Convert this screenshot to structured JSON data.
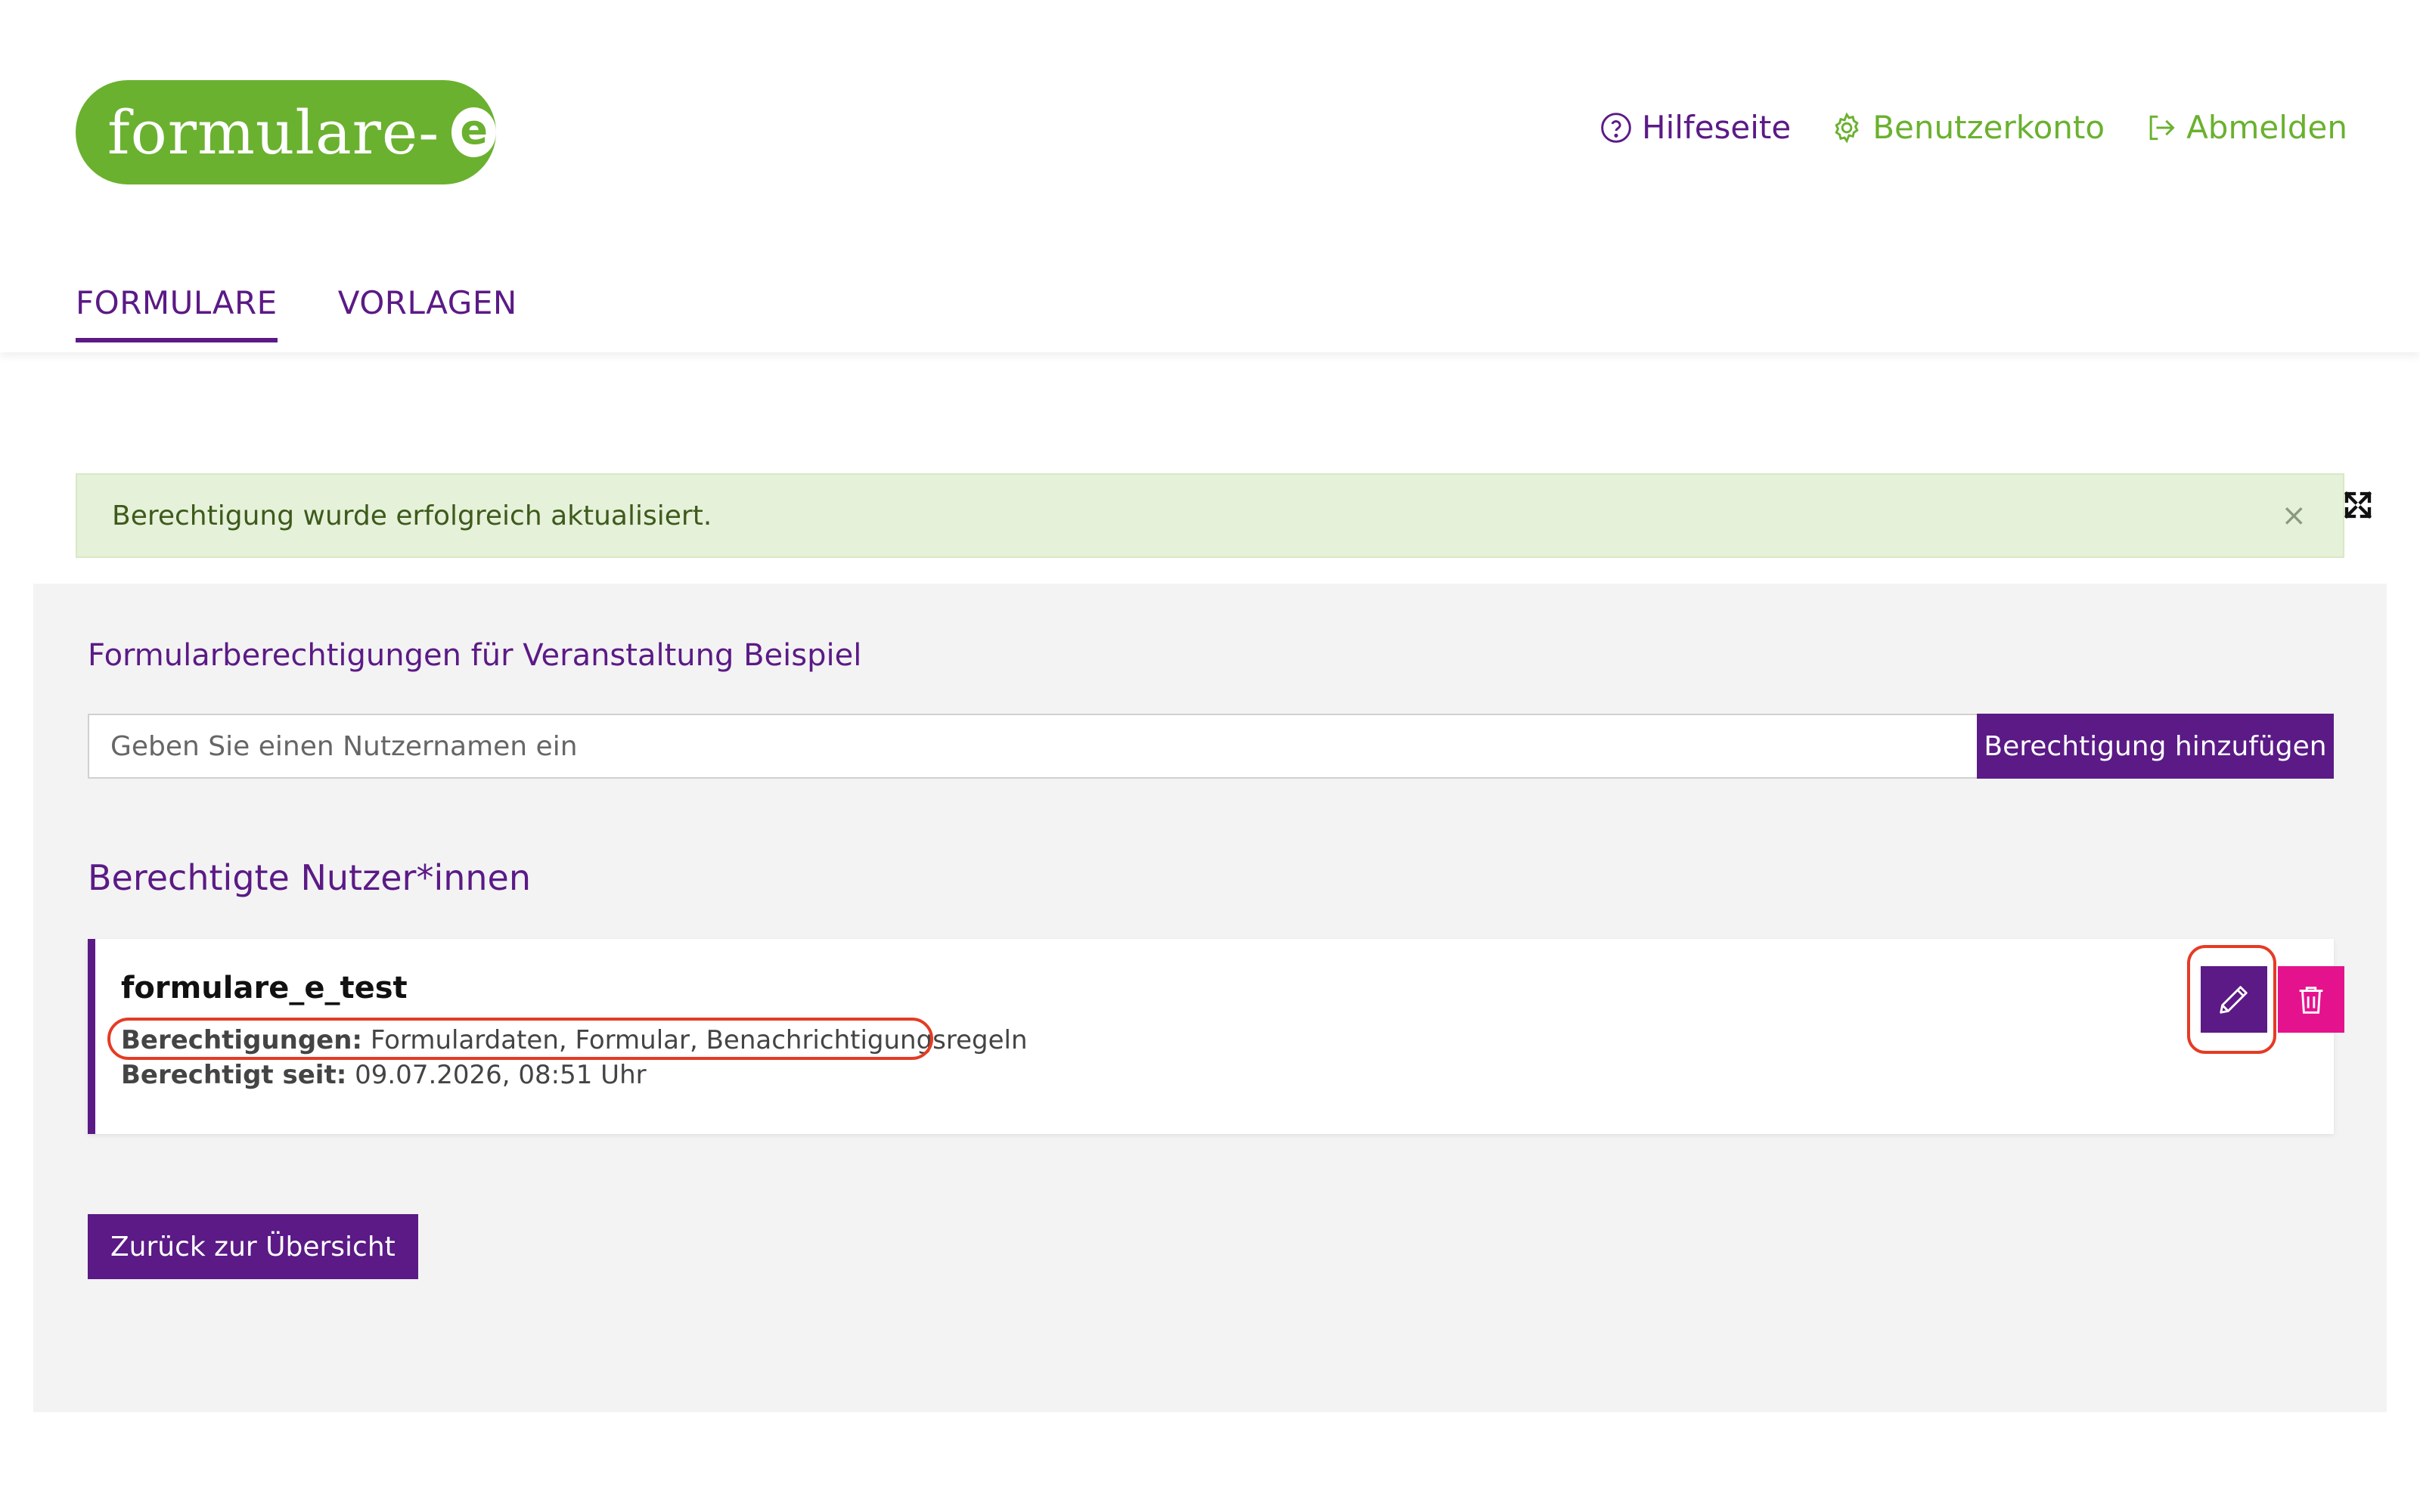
{
  "header": {
    "logo_text": "formulare-",
    "logo_badge": "e",
    "links": {
      "help": "Hilfeseite",
      "account": "Benutzerkonto",
      "logout": "Abmelden"
    },
    "tabs": [
      {
        "label": "FORMULARE",
        "active": true
      },
      {
        "label": "VORLAGEN",
        "active": false
      }
    ]
  },
  "alert": {
    "message": "Berechtigung wurde erfolgreich aktualisiert.",
    "close": "×"
  },
  "permissions": {
    "title": "Formularberechtigungen für Veranstaltung Beispiel",
    "input_placeholder": "Geben Sie einen Nutzernamen ein",
    "input_value": "",
    "add_button": "Berechtigung hinzufügen",
    "users_title": "Berechtigte Nutzer*innen",
    "users": [
      {
        "name": "formulare_e_test",
        "permissions_label": "Berechtigungen:",
        "permissions_value": "Formulardaten, Formular, Benachrichtigungsregeln",
        "since_label": "Berechtigt seit:",
        "since_value": "09.07.2026, 08:51 Uhr"
      }
    ],
    "back_button": "Zurück zur Übersicht"
  },
  "colors": {
    "brand_green": "#6ab12f",
    "brand_purple": "#5b1a86",
    "delete_pink": "#e5128e",
    "highlight_red": "#e53b24",
    "alert_bg": "#e6f1d9"
  },
  "icons": {
    "help": "question-circle-icon",
    "account": "gear-icon",
    "logout": "sign-out-icon",
    "expand": "expand-icon",
    "edit": "pencil-icon",
    "delete": "trash-icon"
  }
}
